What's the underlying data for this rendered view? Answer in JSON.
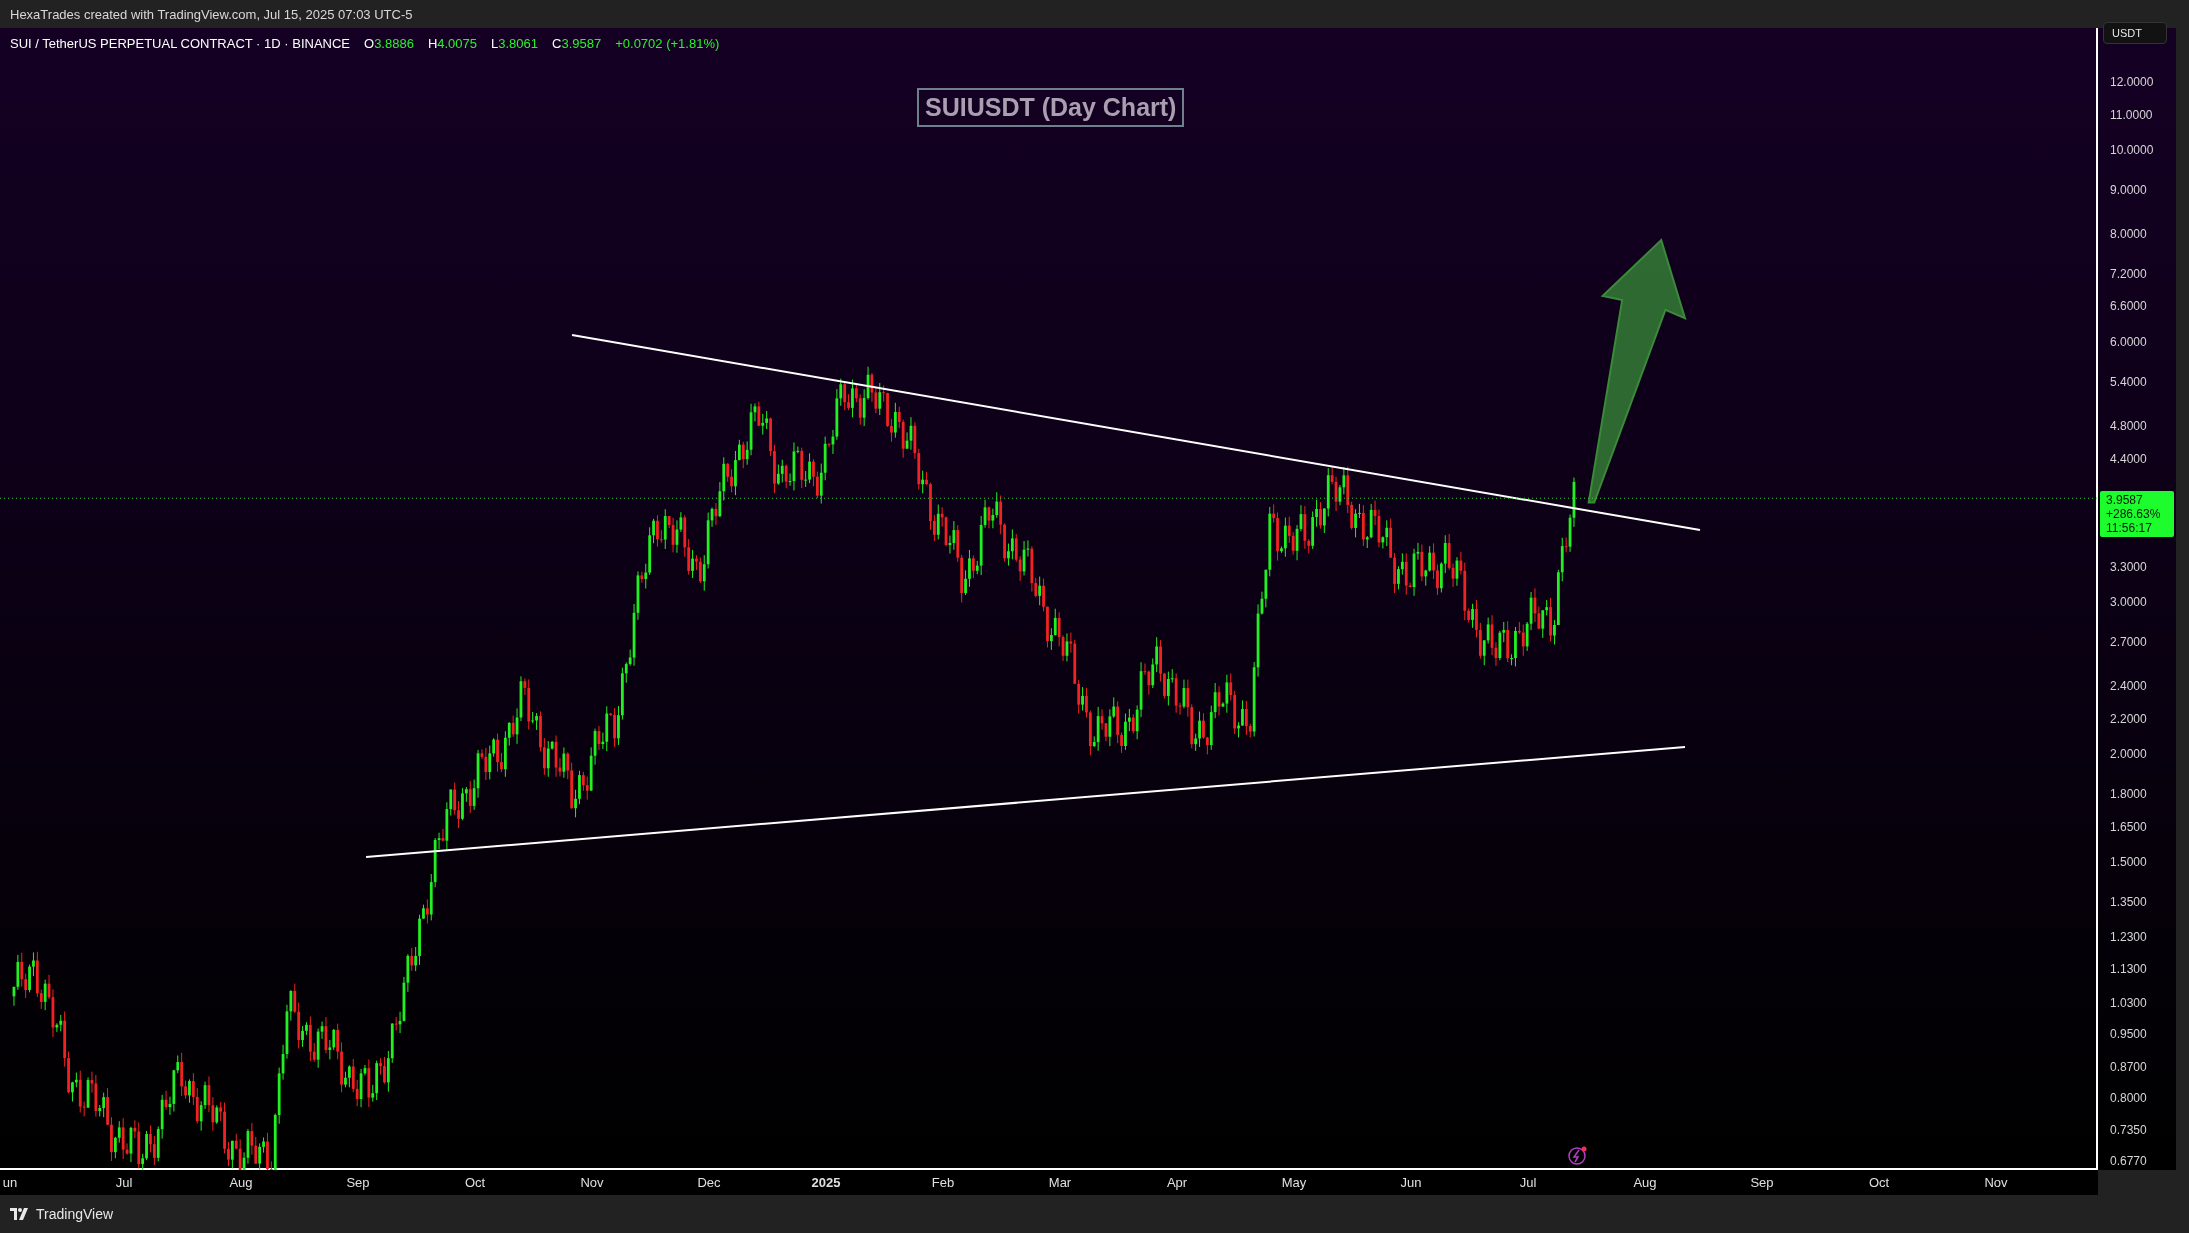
{
  "credit": "HexaTrades created with TradingView.com, Jul 15, 2025 07:03 UTC-5",
  "legend": {
    "symbol": "SUI / TetherUS PERPETUAL CONTRACT · 1D · BINANCE",
    "ohlc": [
      {
        "label": "O",
        "value": "3.8886"
      },
      {
        "label": "H",
        "value": "4.0075"
      },
      {
        "label": "L",
        "value": "3.8061"
      },
      {
        "label": "C",
        "value": "3.9587"
      }
    ],
    "change": "+0.0702 (+1.81%)"
  },
  "chart_title": "SUIUSDT (Day Chart)",
  "price_axis": {
    "currency": "USDT",
    "ticks": [
      "12.0000",
      "11.0000",
      "10.0000",
      "9.0000",
      "8.0000",
      "7.2000",
      "6.6000",
      "6.0000",
      "5.4000",
      "4.8000",
      "4.4000",
      "3.3000",
      "3.0000",
      "2.7000",
      "2.4000",
      "2.2000",
      "2.0000",
      "1.8000",
      "1.6500",
      "1.5000",
      "1.3500",
      "1.2300",
      "1.1300",
      "1.0300",
      "0.9500",
      "0.8700",
      "0.8000",
      "0.7350",
      "0.6770"
    ],
    "last_price": {
      "price": "3.9587",
      "change": "+286.63%",
      "countdown": "11:56:17"
    }
  },
  "time_axis": [
    {
      "label": "un",
      "kind": "month"
    },
    {
      "label": "Jul",
      "kind": "month"
    },
    {
      "label": "Aug",
      "kind": "month"
    },
    {
      "label": "Sep",
      "kind": "month"
    },
    {
      "label": "Oct",
      "kind": "month"
    },
    {
      "label": "Nov",
      "kind": "month"
    },
    {
      "label": "Dec",
      "kind": "month"
    },
    {
      "label": "2025",
      "kind": "year"
    },
    {
      "label": "Feb",
      "kind": "month"
    },
    {
      "label": "Mar",
      "kind": "month"
    },
    {
      "label": "Apr",
      "kind": "month"
    },
    {
      "label": "May",
      "kind": "month"
    },
    {
      "label": "Jun",
      "kind": "month"
    },
    {
      "label": "Jul",
      "kind": "month"
    },
    {
      "label": "Aug",
      "kind": "month"
    },
    {
      "label": "Sep",
      "kind": "month"
    },
    {
      "label": "Oct",
      "kind": "month"
    },
    {
      "label": "Nov",
      "kind": "month"
    }
  ],
  "footer": {
    "brand": "TradingView"
  }
}
